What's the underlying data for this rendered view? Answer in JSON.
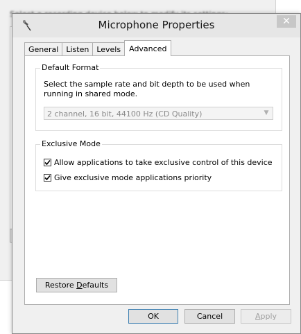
{
  "background_window": {
    "partial_text": "Select a recording device below to modify its settings:"
  },
  "dialog": {
    "title": "Microphone Properties",
    "close_glyph": "✕",
    "tabs": [
      {
        "label": "General",
        "active": false
      },
      {
        "label": "Listen",
        "active": false
      },
      {
        "label": "Levels",
        "active": false
      },
      {
        "label": "Advanced",
        "active": true
      }
    ],
    "default_format": {
      "legend": "Default Format",
      "description": "Select the sample rate and bit depth to be used when running in shared mode.",
      "selected_value": "2 channel, 16 bit, 44100 Hz (CD Quality)",
      "enabled": false
    },
    "exclusive_mode": {
      "legend": "Exclusive Mode",
      "options": [
        {
          "label": "Allow applications to take exclusive control of this device",
          "checked": true
        },
        {
          "label": "Give exclusive mode applications priority",
          "checked": true
        }
      ]
    },
    "restore_defaults": {
      "label_before": "Restore ",
      "label_accel": "D",
      "label_after": "efaults"
    },
    "buttons": {
      "ok": "OK",
      "cancel": "Cancel",
      "apply_accel": "A",
      "apply_rest": "pply"
    }
  }
}
